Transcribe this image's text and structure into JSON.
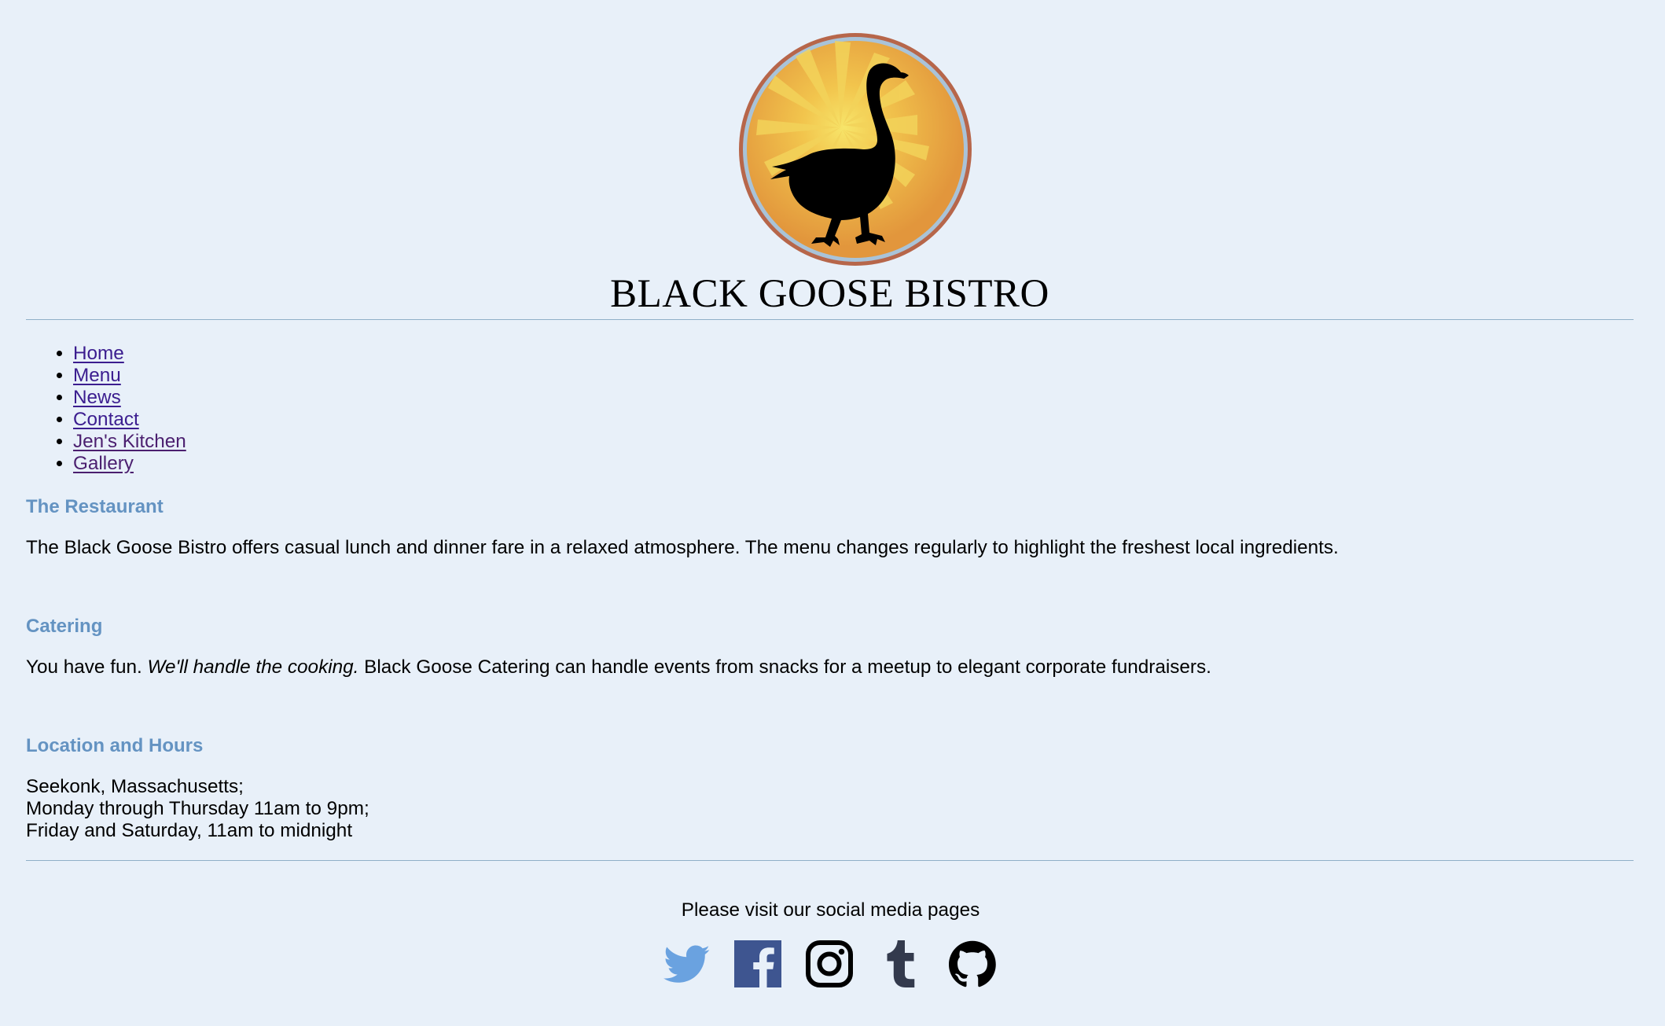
{
  "site": {
    "title": "BLACK GOOSE BISTRO",
    "logo_icon": "goose-sunburst-logo"
  },
  "nav": {
    "items": [
      {
        "label": "Home"
      },
      {
        "label": "Menu"
      },
      {
        "label": "News"
      },
      {
        "label": "Contact"
      },
      {
        "label": "Jen's Kitchen"
      },
      {
        "label": "Gallery"
      }
    ]
  },
  "sections": {
    "restaurant": {
      "heading": "The Restaurant",
      "text": "The Black Goose Bistro offers casual lunch and dinner fare in a relaxed atmosphere. The menu changes regularly to highlight the freshest local ingredients."
    },
    "catering": {
      "heading": "Catering",
      "text_before": "You have fun. ",
      "text_emphasis": "We'll handle the cooking.",
      "text_after": " Black Goose Catering can handle events from snacks for a meetup to elegant corporate fundraisers."
    },
    "location": {
      "heading": "Location and Hours",
      "lines": [
        "Seekonk, Massachusetts;",
        "Monday through Thursday 11am to 9pm;",
        "Friday and Saturday, 11am to midnight"
      ]
    }
  },
  "footer": {
    "social_text": "Please visit our social media pages",
    "social_icons": [
      "twitter-icon",
      "facebook-icon",
      "instagram-icon",
      "tumblr-icon",
      "github-icon"
    ]
  },
  "colors": {
    "background": "#e8f0f9",
    "heading": "#6493c2",
    "link": "#3b1d8f",
    "rule": "#8fb0c8",
    "twitter": "#6aa2e0",
    "facebook": "#3e5590",
    "tumblr": "#333a4d",
    "logo_orange": "#e2963c",
    "logo_ring": "#b7664a"
  }
}
